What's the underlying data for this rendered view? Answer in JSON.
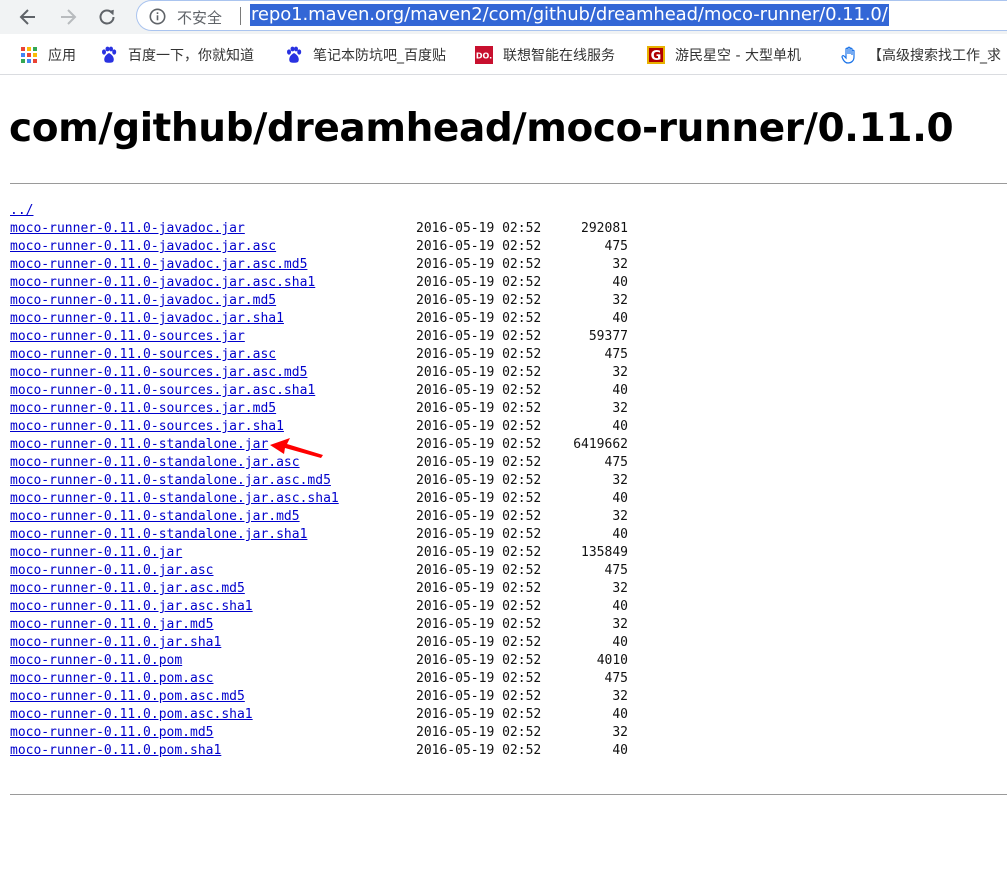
{
  "browser": {
    "security_label": "不安全",
    "url": "repo1.maven.org/maven2/com/github/dreamhead/moco-runner/0.11.0/",
    "bookmarks": [
      {
        "label": "应用",
        "icon": "apps-grid-icon"
      },
      {
        "label": "百度一下，你就知道",
        "icon": "baidu-paw-icon"
      },
      {
        "label": "笔记本防坑吧_百度贴",
        "icon": "baidu-paw-icon"
      },
      {
        "label": "联想智能在线服务",
        "icon": "lenovo-icon"
      },
      {
        "label": "游民星空 - 大型单机",
        "icon": "gamersky-icon"
      },
      {
        "label": "【高级搜索找工作_求",
        "icon": "hand-icon"
      }
    ]
  },
  "page": {
    "title": "com/github/dreamhead/moco-runner/0.11.0",
    "parent_link": "../",
    "files": [
      {
        "name": "moco-runner-0.11.0-javadoc.jar",
        "date": "2016-05-19 02:52",
        "size": "292081"
      },
      {
        "name": "moco-runner-0.11.0-javadoc.jar.asc",
        "date": "2016-05-19 02:52",
        "size": "475"
      },
      {
        "name": "moco-runner-0.11.0-javadoc.jar.asc.md5",
        "date": "2016-05-19 02:52",
        "size": "32"
      },
      {
        "name": "moco-runner-0.11.0-javadoc.jar.asc.sha1",
        "date": "2016-05-19 02:52",
        "size": "40"
      },
      {
        "name": "moco-runner-0.11.0-javadoc.jar.md5",
        "date": "2016-05-19 02:52",
        "size": "32"
      },
      {
        "name": "moco-runner-0.11.0-javadoc.jar.sha1",
        "date": "2016-05-19 02:52",
        "size": "40"
      },
      {
        "name": "moco-runner-0.11.0-sources.jar",
        "date": "2016-05-19 02:52",
        "size": "59377"
      },
      {
        "name": "moco-runner-0.11.0-sources.jar.asc",
        "date": "2016-05-19 02:52",
        "size": "475"
      },
      {
        "name": "moco-runner-0.11.0-sources.jar.asc.md5",
        "date": "2016-05-19 02:52",
        "size": "32"
      },
      {
        "name": "moco-runner-0.11.0-sources.jar.asc.sha1",
        "date": "2016-05-19 02:52",
        "size": "40"
      },
      {
        "name": "moco-runner-0.11.0-sources.jar.md5",
        "date": "2016-05-19 02:52",
        "size": "32"
      },
      {
        "name": "moco-runner-0.11.0-sources.jar.sha1",
        "date": "2016-05-19 02:52",
        "size": "40"
      },
      {
        "name": "moco-runner-0.11.0-standalone.jar",
        "date": "2016-05-19 02:52",
        "size": "6419662"
      },
      {
        "name": "moco-runner-0.11.0-standalone.jar.asc",
        "date": "2016-05-19 02:52",
        "size": "475"
      },
      {
        "name": "moco-runner-0.11.0-standalone.jar.asc.md5",
        "date": "2016-05-19 02:52",
        "size": "32"
      },
      {
        "name": "moco-runner-0.11.0-standalone.jar.asc.sha1",
        "date": "2016-05-19 02:52",
        "size": "40"
      },
      {
        "name": "moco-runner-0.11.0-standalone.jar.md5",
        "date": "2016-05-19 02:52",
        "size": "32"
      },
      {
        "name": "moco-runner-0.11.0-standalone.jar.sha1",
        "date": "2016-05-19 02:52",
        "size": "40"
      },
      {
        "name": "moco-runner-0.11.0.jar",
        "date": "2016-05-19 02:52",
        "size": "135849"
      },
      {
        "name": "moco-runner-0.11.0.jar.asc",
        "date": "2016-05-19 02:52",
        "size": "475"
      },
      {
        "name": "moco-runner-0.11.0.jar.asc.md5",
        "date": "2016-05-19 02:52",
        "size": "32"
      },
      {
        "name": "moco-runner-0.11.0.jar.asc.sha1",
        "date": "2016-05-19 02:52",
        "size": "40"
      },
      {
        "name": "moco-runner-0.11.0.jar.md5",
        "date": "2016-05-19 02:52",
        "size": "32"
      },
      {
        "name": "moco-runner-0.11.0.jar.sha1",
        "date": "2016-05-19 02:52",
        "size": "40"
      },
      {
        "name": "moco-runner-0.11.0.pom",
        "date": "2016-05-19 02:52",
        "size": "4010"
      },
      {
        "name": "moco-runner-0.11.0.pom.asc",
        "date": "2016-05-19 02:52",
        "size": "475"
      },
      {
        "name": "moco-runner-0.11.0.pom.asc.md5",
        "date": "2016-05-19 02:52",
        "size": "32"
      },
      {
        "name": "moco-runner-0.11.0.pom.asc.sha1",
        "date": "2016-05-19 02:52",
        "size": "40"
      },
      {
        "name": "moco-runner-0.11.0.pom.md5",
        "date": "2016-05-19 02:52",
        "size": "32"
      },
      {
        "name": "moco-runner-0.11.0.pom.sha1",
        "date": "2016-05-19 02:52",
        "size": "40"
      }
    ]
  },
  "colors": {
    "link": "#0000cc",
    "url_highlight": "#3367d6",
    "annotation_arrow": "#ff0000"
  }
}
